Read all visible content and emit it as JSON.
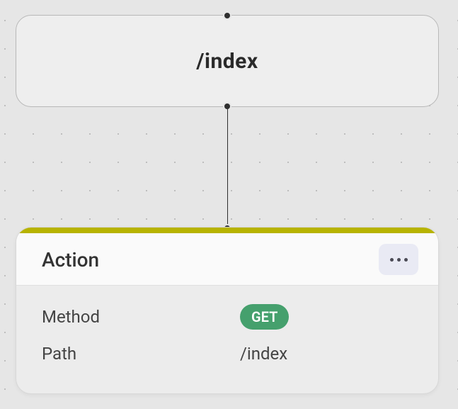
{
  "colors": {
    "accent": "#b7b300",
    "method_get": "#45a06d"
  },
  "route_node": {
    "label": "/index"
  },
  "action_node": {
    "title": "Action",
    "properties": {
      "method": {
        "label": "Method",
        "value": "GET"
      },
      "path": {
        "label": "Path",
        "value": "/index"
      }
    }
  },
  "icons": {
    "more": "ellipsis-horizontal"
  }
}
